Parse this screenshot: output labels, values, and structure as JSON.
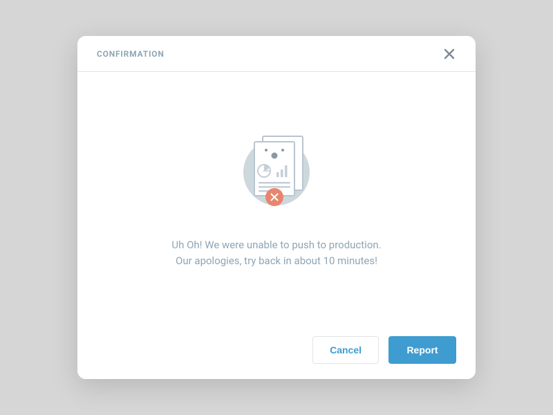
{
  "modal": {
    "title": "CONFIRMATION",
    "message_line1": "Uh Oh! We were unable to push to production.",
    "message_line2": "Our apologies, try back in about 10 minutes!",
    "cancel_label": "Cancel",
    "report_label": "Report"
  },
  "colors": {
    "accent": "#3e9cd0",
    "error_badge": "#e8856d",
    "muted_text": "#8fa5b5"
  }
}
